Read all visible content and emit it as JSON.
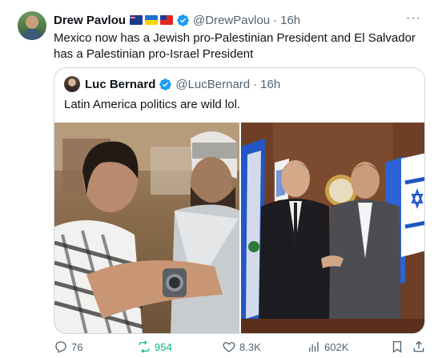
{
  "tweet": {
    "author_name": "Drew Pavlou",
    "flags": [
      "australia-flag",
      "ukraine-flag",
      "taiwan-flag"
    ],
    "handle": "@DrewPavlou",
    "separator": "·",
    "time": "16h",
    "more": "···",
    "text": "Mexico now has a Jewish pro-Palestinian  President and El Salvador has a Palestinian pro-Israel President"
  },
  "quote": {
    "author_name": "Luc Bernard",
    "handle": "@LucBernard",
    "separator": "·",
    "time": "16h",
    "text": "Latin America politics are wild lol."
  },
  "actions": {
    "replies": "76",
    "reposts": "954",
    "likes": "8.3K",
    "views": "602K"
  },
  "colors": {
    "text": "#0f1419",
    "muted": "#536471",
    "verified": "#1d9bf0",
    "repost_active": "#00ba7c",
    "border": "#cfd9de"
  }
}
